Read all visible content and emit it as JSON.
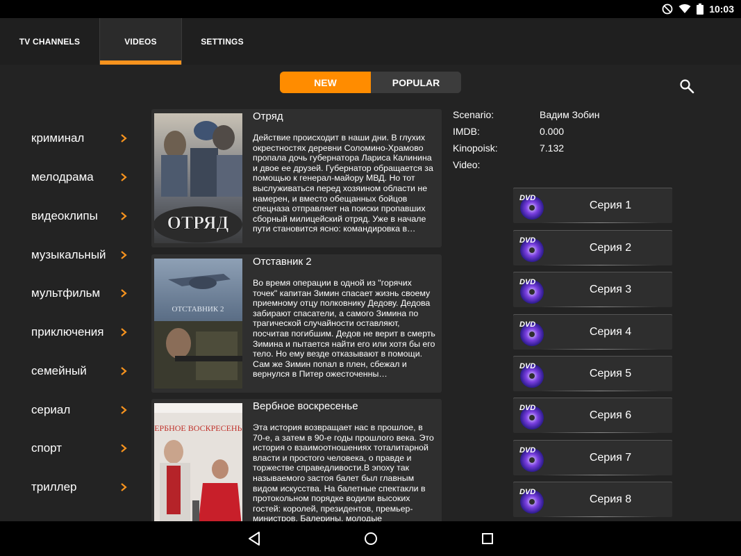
{
  "status_bar": {
    "time": "10:03",
    "icons": [
      "dnd-icon",
      "wifi-icon",
      "battery-icon"
    ]
  },
  "tabs": [
    {
      "label": "TV CHANNELS",
      "active": false
    },
    {
      "label": "VIDEOS",
      "active": true
    },
    {
      "label": "SETTINGS",
      "active": false
    }
  ],
  "segmented": {
    "new_label": "NEW",
    "popular_label": "POPULAR",
    "selected": "NEW"
  },
  "genres": [
    "криминал",
    "мелодрама",
    "видеоклипы",
    "музыкальный",
    "мультфильм",
    "приключения",
    "семейный",
    "сериал",
    "спорт",
    "триллер"
  ],
  "videos": [
    {
      "title": "Отряд",
      "description": "Действие происходит в наши дни. В глухих окрестностях деревни Соломино-Храмово пропала дочь губернатора Лариса Калинина и двое ее друзей. Губернатор обращается за помощью к генерал-майору МВД. Но тот выслуживаться перед хозяином области не намерен, и вместо обещанных бойцов спецназа отправляет на поиски пропавших сборный милицейский отряд. Уже в начале пути становится ясно: командировка в…",
      "poster_text": "ОТРЯД"
    },
    {
      "title": "Отставник 2",
      "description": "Во время операции в одной из \"горячих точек\" капитан Зимин спасает жизнь своему приемному отцу полковнику Дедову. Дедова забирают спасатели, а самого Зимина по трагической случайности оставляют, посчитав погибшим. Дедов не верит в смерть Зимина и пытается найти его или хотя бы его тело. Но ему везде отказывают в помощи. Сам же Зимин попал в плен, сбежал и вернулся в Питер ожесточенны…",
      "poster_text": "ОТСТАВНИК 2"
    },
    {
      "title": "Вербное воскресенье",
      "description": "Эта история возвращает нас в прошлое, в 70-е, а затем в 90-е годы прошлого века. Это история о взаимоотношениях тоталитарной власти и простого человека, о правде и торжестве справедливости.В эпоху так называемого застоя балет был главным видом искусства. На балетные спектакли в протокольном порядке водили высоких гостей: королей, президентов, премьер-министров. Балерины, молодые",
      "poster_text": "ВЕРБНОЕ ВОСКРЕСЕНЬЕ"
    }
  ],
  "details": {
    "scenario_label": "Scenario:",
    "scenario_value": "Вадим Зобин",
    "imdb_label": "IMDB:",
    "imdb_value": "0.000",
    "kinopoisk_label": "Kinopoisk:",
    "kinopoisk_value": "7.132",
    "video_label": "Video:",
    "video_value": ""
  },
  "episodes": [
    "Серия 1",
    "Серия 2",
    "Серия 3",
    "Серия 4",
    "Серия 5",
    "Серия 6",
    "Серия 7",
    "Серия 8"
  ],
  "colors": {
    "accent": "#ff8c00",
    "background": "#232323",
    "card": "#2f2f2f",
    "tabbar": "#1f1f1f"
  }
}
